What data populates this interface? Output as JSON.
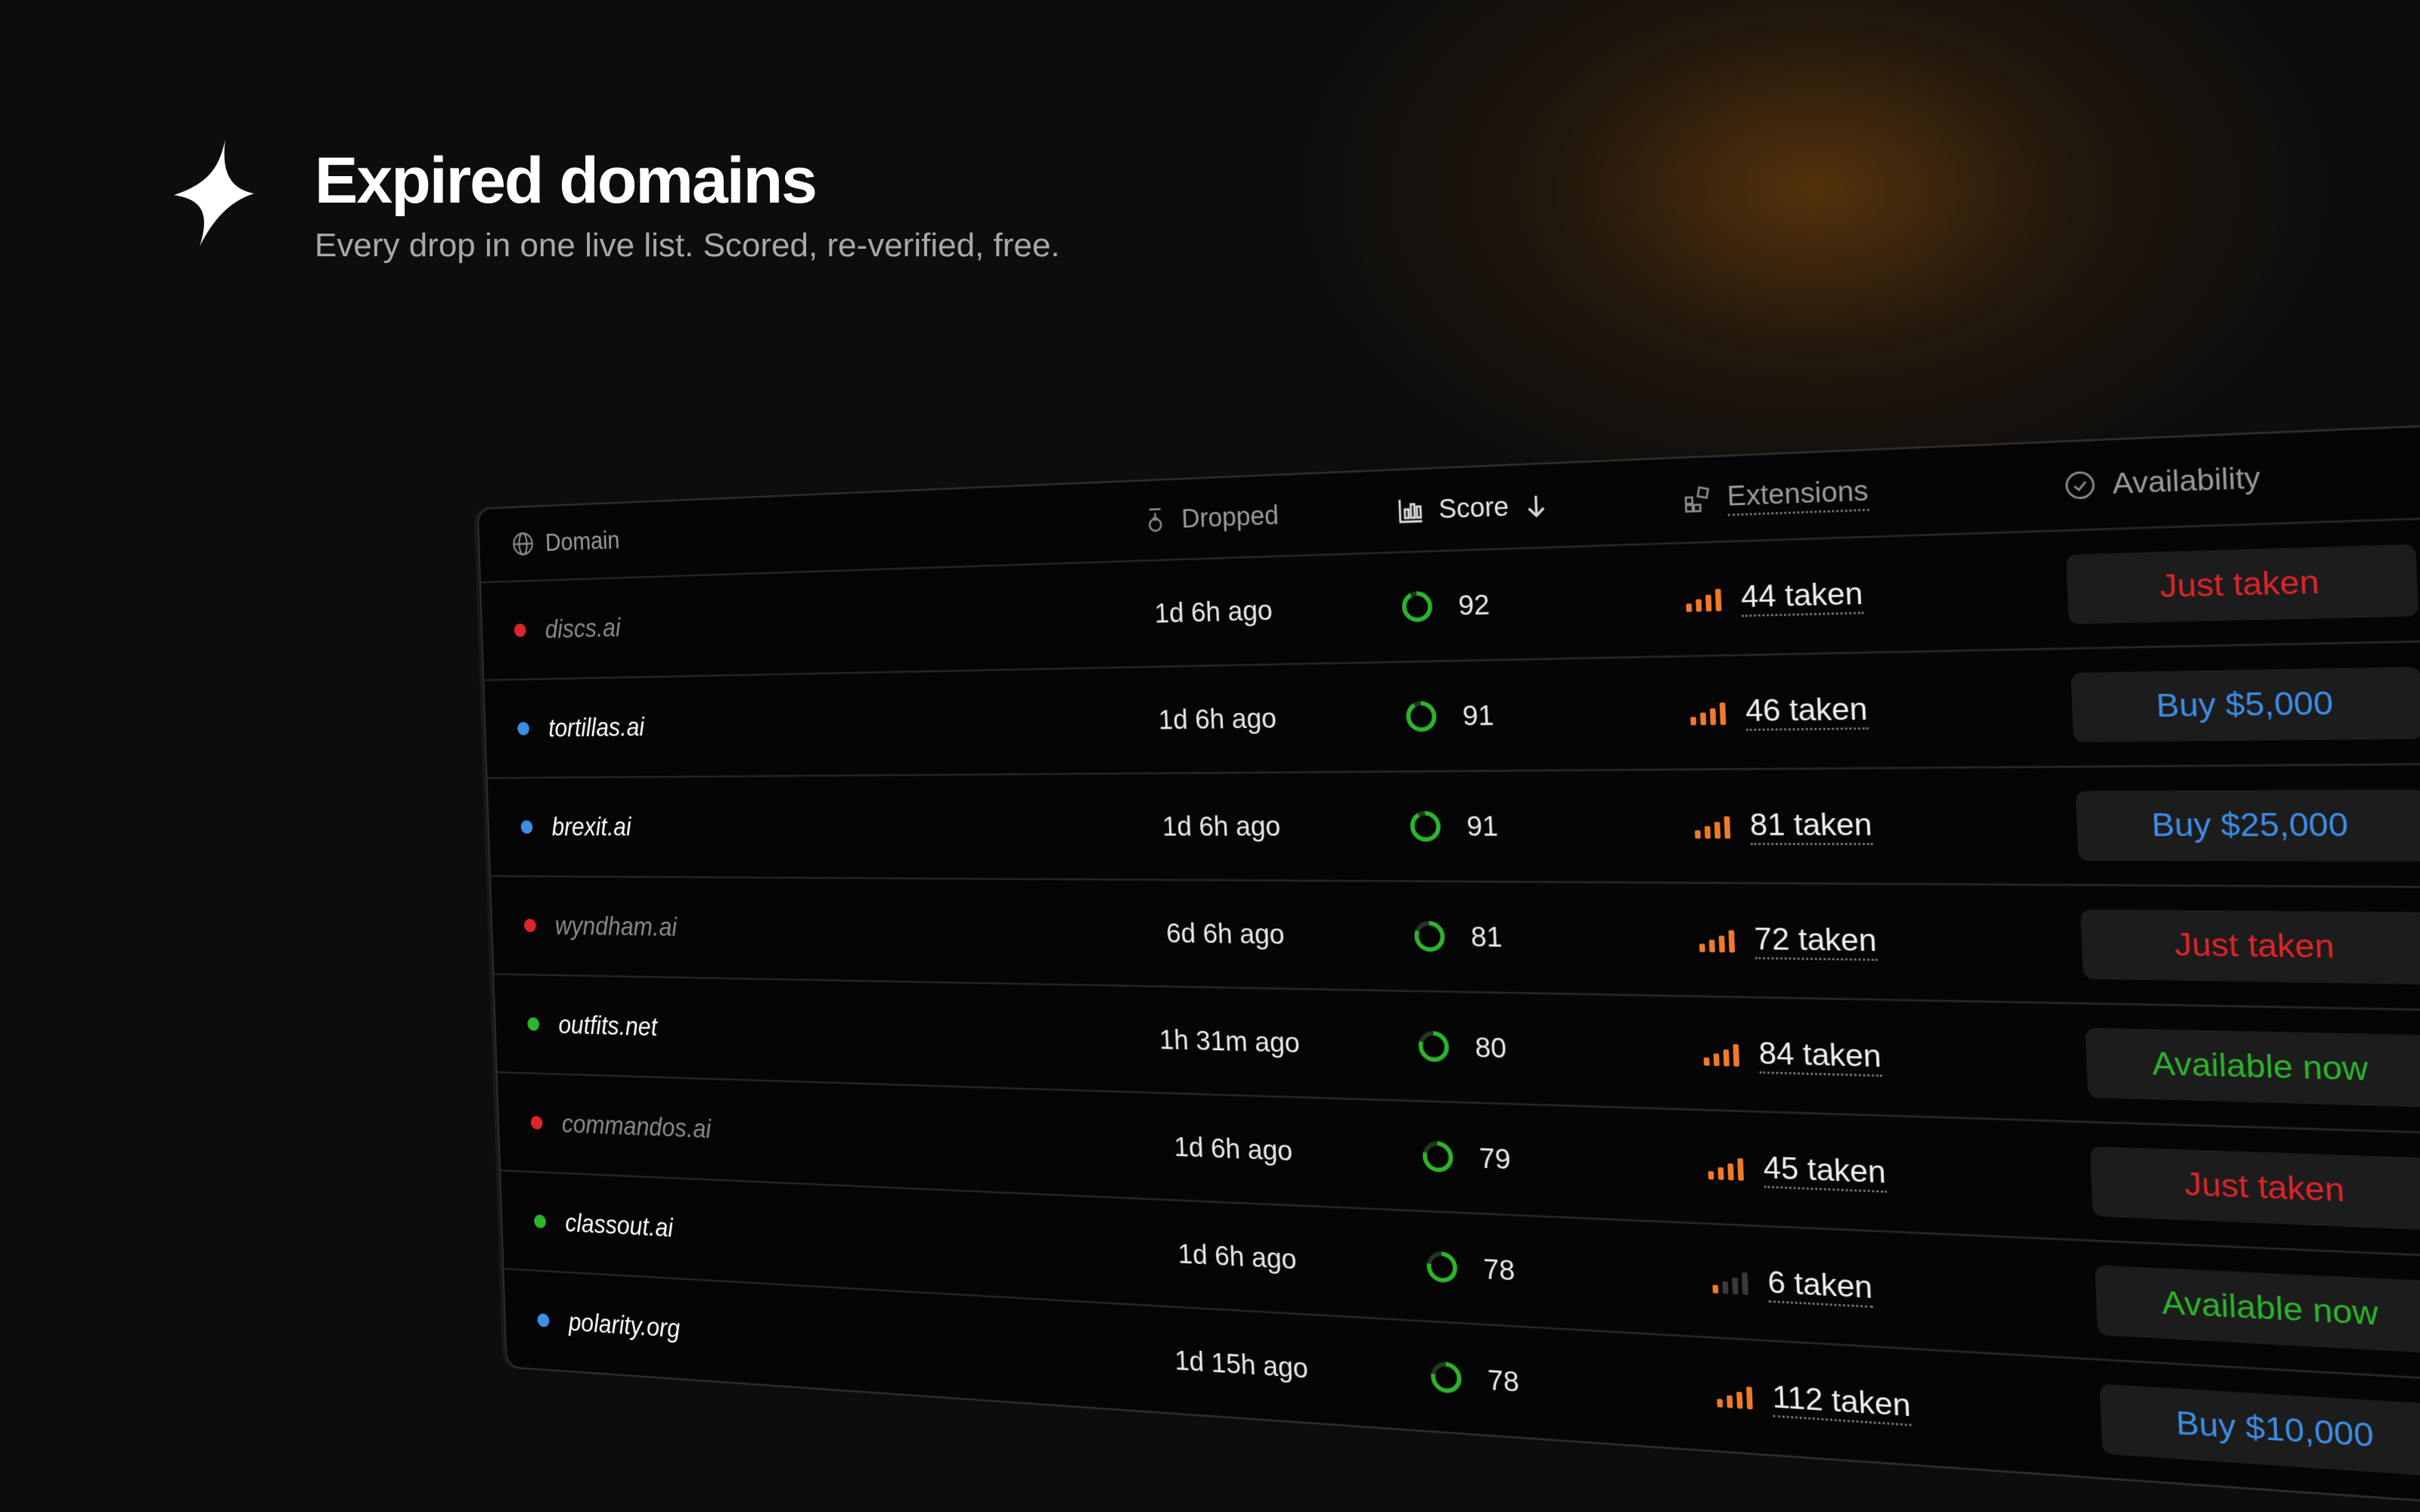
{
  "header": {
    "title": "Expired domains",
    "subtitle": "Every drop in one live list. Scored, re-verified, free.",
    "logo_icon": "lightning-icon"
  },
  "colors": {
    "taken": "#e0242b",
    "buy": "#3d8ee6",
    "available": "#2cb52c",
    "ring": "#2cb52c",
    "bars": "#f07a2a"
  },
  "table": {
    "columns": {
      "domain": "Domain",
      "dropped": "Dropped",
      "score": "Score",
      "extensions": "Extensions",
      "availability": "Availability"
    },
    "rows": [
      {
        "status": "taken",
        "domain": "discs.ai",
        "dropped": "1d 6h ago",
        "score": "92",
        "ext": "44 taken",
        "avail": "Just taken",
        "bars": 4
      },
      {
        "status": "buy",
        "domain": "tortillas.ai",
        "dropped": "1d 6h ago",
        "score": "91",
        "ext": "46 taken",
        "avail": "Buy $5,000",
        "bars": 4
      },
      {
        "status": "buy",
        "domain": "brexit.ai",
        "dropped": "1d 6h ago",
        "score": "91",
        "ext": "81 taken",
        "avail": "Buy $25,000",
        "bars": 4
      },
      {
        "status": "taken",
        "domain": "wyndham.ai",
        "dropped": "6d 6h ago",
        "score": "81",
        "ext": "72 taken",
        "avail": "Just taken",
        "bars": 4
      },
      {
        "status": "available",
        "domain": "outfits.net",
        "dropped": "1h 31m ago",
        "score": "80",
        "ext": "84 taken",
        "avail": "Available now",
        "bars": 4
      },
      {
        "status": "taken",
        "domain": "commandos.ai",
        "dropped": "1d 6h ago",
        "score": "79",
        "ext": "45 taken",
        "avail": "Just taken",
        "bars": 4
      },
      {
        "status": "available",
        "domain": "classout.ai",
        "dropped": "1d 6h ago",
        "score": "78",
        "ext": "6 taken",
        "avail": "Available now",
        "bars": 1
      },
      {
        "status": "buy",
        "domain": "polarity.org",
        "dropped": "1d 15h ago",
        "score": "78",
        "ext": "112 taken",
        "avail": "Buy $10,000",
        "bars": 4
      }
    ]
  }
}
